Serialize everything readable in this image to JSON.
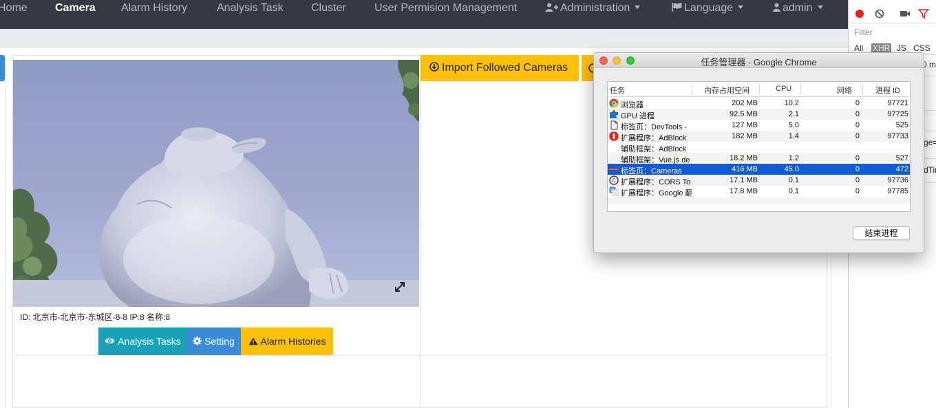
{
  "navbar": {
    "items": [
      {
        "label": "Home"
      },
      {
        "label": "Camera"
      },
      {
        "label": "Alarm History"
      },
      {
        "label": "Analysis Task"
      },
      {
        "label": "Cluster"
      },
      {
        "label": "User Permision Management"
      },
      {
        "label": "Administration"
      },
      {
        "label": "Language"
      },
      {
        "label": "admin"
      }
    ]
  },
  "toolbar": {
    "import_label": "Import Followed Cameras"
  },
  "camera": {
    "info": "ID: 北京市-北京市-东城区-8-8 IP:8 名称:8",
    "buttons": {
      "analysis": "Analysis Tasks",
      "setting": "Setting",
      "alarms": "Alarm Histories"
    }
  },
  "devtools": {
    "filter_label": "Filter",
    "types": [
      "All",
      "XHR",
      "JS",
      "CSS"
    ],
    "fragments": [
      "0 m",
      "ge=",
      "dTim"
    ]
  },
  "task_manager": {
    "title": "任务管理器 - Google Chrome",
    "columns": {
      "task": "任务",
      "memory": "内存占用空间",
      "cpu": "CPU",
      "network": "网络",
      "pid": "进程 ID"
    },
    "rows": [
      {
        "icon": "chrome-icon",
        "name": "浏览器",
        "memory": "202 MB",
        "cpu": "10.2",
        "network": "0",
        "pid": "97721"
      },
      {
        "icon": "puzzle-icon",
        "name": "GPU 进程",
        "memory": "92.5 MB",
        "cpu": "2.1",
        "network": "0",
        "pid": "97725"
      },
      {
        "icon": "page-icon",
        "name": "标签页：DevTools -",
        "memory": "127 MB",
        "cpu": "5.0",
        "network": "0",
        "pid": "525"
      },
      {
        "icon": "adblock-icon",
        "name": "扩展程序：AdBlock",
        "memory": "182 MB",
        "cpu": "1.4",
        "network": "0",
        "pid": "97733"
      },
      {
        "icon": "",
        "name": "辅助框架：AdBlock",
        "memory": "",
        "cpu": "",
        "network": "",
        "pid": ""
      },
      {
        "icon": "",
        "name": "辅助框架：Vue.js de",
        "memory": "18.2 MB",
        "cpu": "1.2",
        "network": "0",
        "pid": "527"
      },
      {
        "icon": "camera-tab-icon",
        "name": "标签页：Cameras",
        "memory": "416 MB",
        "cpu": "45.0",
        "network": "0",
        "pid": "472"
      },
      {
        "icon": "cors-icon",
        "name": "扩展程序：CORS To",
        "memory": "17.1 MB",
        "cpu": "0.1",
        "network": "0",
        "pid": "97736"
      },
      {
        "icon": "google-translate-icon",
        "name": "扩展程序：Google 翻",
        "memory": "17.8 MB",
        "cpu": "0.1",
        "network": "0",
        "pid": "97785"
      }
    ],
    "selected_row": 6,
    "end_process_label": "结束进程"
  },
  "colors": {
    "navbar_bg": "#343a40",
    "info_btn": "#17a2b8",
    "primary_btn": "#3a8bd8",
    "warning_btn": "#ffc107",
    "selection": "#0f5bd0"
  }
}
